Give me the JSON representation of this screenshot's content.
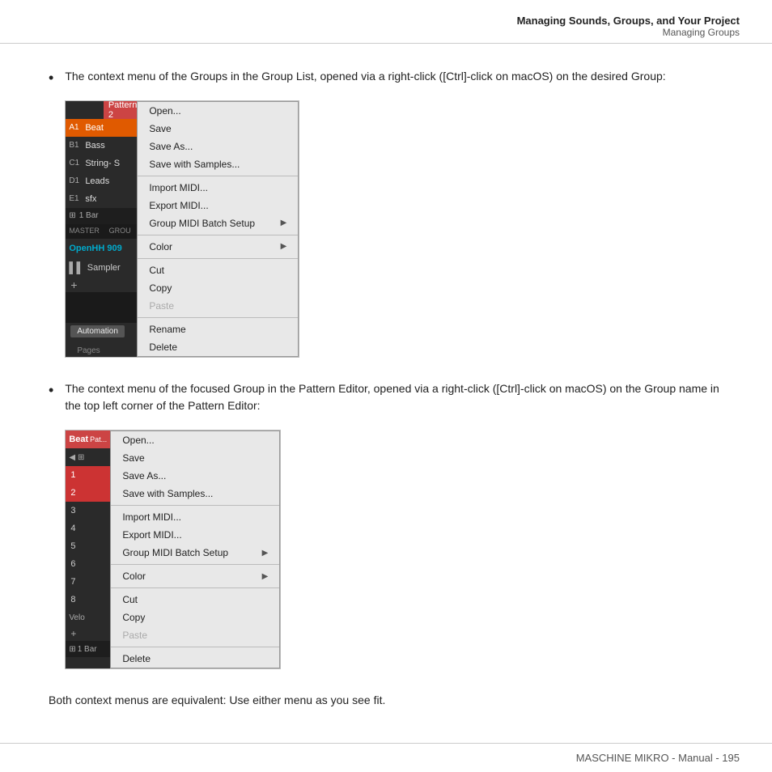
{
  "header": {
    "title": "Managing Sounds, Groups, and Your Project",
    "subtitle": "Managing Groups"
  },
  "bullet1": {
    "text": "The context menu of the Groups in the Group List, opened via a right-click ([Ctrl]-click on macOS) on the desired Group:"
  },
  "screenshot1": {
    "groups": [
      {
        "letter": "A1",
        "name": "Beat",
        "active": true
      },
      {
        "letter": "B1",
        "name": "Bass",
        "active": false
      },
      {
        "letter": "C1",
        "name": "String- S",
        "active": false
      },
      {
        "letter": "D1",
        "name": "Leads",
        "active": false
      },
      {
        "letter": "E1",
        "name": "sfx",
        "active": false
      }
    ],
    "bar_label": "1 Bar",
    "master_label": "MASTER",
    "group_label": "GROU",
    "open_hh": "OpenHH 909",
    "sampler": "Sampler",
    "automation_btn": "Automation",
    "pages_label": "Pages",
    "header_pattern": "Pattern 2",
    "menu_items": [
      {
        "label": "Open...",
        "disabled": false,
        "has_arrow": false
      },
      {
        "label": "Save",
        "disabled": false,
        "has_arrow": false
      },
      {
        "label": "Save As...",
        "disabled": false,
        "has_arrow": false
      },
      {
        "label": "Save with Samples...",
        "disabled": false,
        "has_arrow": false
      },
      {
        "separator": true
      },
      {
        "label": "Import MIDI...",
        "disabled": false,
        "has_arrow": false
      },
      {
        "label": "Export MIDI...",
        "disabled": false,
        "has_arrow": false
      },
      {
        "label": "Group MIDI Batch Setup",
        "disabled": false,
        "has_arrow": true
      },
      {
        "separator": true
      },
      {
        "label": "Color",
        "disabled": false,
        "has_arrow": true
      },
      {
        "separator": true
      },
      {
        "label": "Cut",
        "disabled": false,
        "has_arrow": false
      },
      {
        "label": "Copy",
        "disabled": false,
        "has_arrow": false
      },
      {
        "label": "Paste",
        "disabled": true,
        "has_arrow": false
      },
      {
        "separator": true
      },
      {
        "label": "Rename",
        "disabled": false,
        "has_arrow": false
      },
      {
        "label": "Delete",
        "disabled": false,
        "has_arrow": false
      }
    ]
  },
  "bullet2": {
    "text": "The context menu of the focused Group in the Pattern Editor, opened via a right-click ([Ctrl]-click on macOS) on the Group name in the top left corner of the Pattern Editor:"
  },
  "screenshot2": {
    "header_text": "Beat",
    "rows": [
      "1",
      "2",
      "3",
      "4",
      "5",
      "6",
      "7",
      "8"
    ],
    "velo_label": "Velo",
    "bar_label": "1 Bar",
    "menu_items": [
      {
        "label": "Open...",
        "disabled": false,
        "has_arrow": false
      },
      {
        "label": "Save",
        "disabled": false,
        "has_arrow": false
      },
      {
        "label": "Save As...",
        "disabled": false,
        "has_arrow": false
      },
      {
        "label": "Save with Samples...",
        "disabled": false,
        "has_arrow": false
      },
      {
        "separator": true
      },
      {
        "label": "Import MIDI...",
        "disabled": false,
        "has_arrow": false
      },
      {
        "label": "Export MIDI...",
        "disabled": false,
        "has_arrow": false
      },
      {
        "label": "Group MIDI Batch Setup",
        "disabled": false,
        "has_arrow": true
      },
      {
        "separator": true
      },
      {
        "label": "Color",
        "disabled": false,
        "has_arrow": true
      },
      {
        "separator": true
      },
      {
        "label": "Cut",
        "disabled": false,
        "has_arrow": false
      },
      {
        "label": "Copy",
        "disabled": false,
        "has_arrow": false
      },
      {
        "label": "Paste",
        "disabled": true,
        "has_arrow": false
      },
      {
        "separator": true
      },
      {
        "label": "Delete",
        "disabled": false,
        "has_arrow": false
      }
    ]
  },
  "conclusion": {
    "text": "Both context menus are equivalent: Use either menu as you see fit."
  },
  "footer": {
    "text": "MASCHINE MIKRO - Manual - 195"
  }
}
